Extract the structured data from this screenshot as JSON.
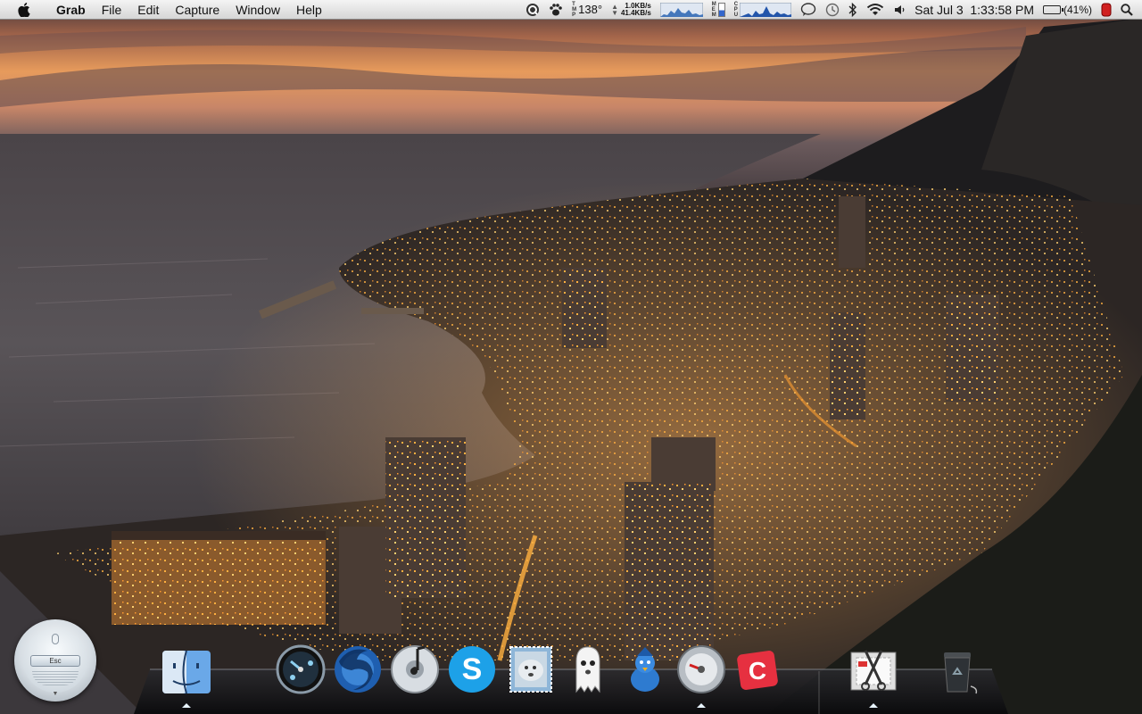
{
  "menubar": {
    "app_name": "Grab",
    "menus": [
      "File",
      "Edit",
      "Capture",
      "Window",
      "Help"
    ],
    "temperature": "138°",
    "net_up": "1.0KB/s",
    "net_down": "41.4KB/s",
    "clock": "Sat Jul 3  1:33:58 PM",
    "battery": "(41%)",
    "labels": {
      "tmp": [
        "T",
        "M",
        "P"
      ],
      "mem": [
        "M",
        "E",
        "M"
      ],
      "cpu": [
        "C",
        "P",
        "U"
      ]
    }
  },
  "widget": {
    "esc_label": "Esc"
  },
  "dock": {
    "apps": [
      {
        "name": "finder",
        "icon": "finder-icon",
        "running": true
      },
      {
        "name": "dashboard",
        "icon": "dashboard-icon",
        "running": false
      },
      {
        "name": "firefox",
        "icon": "firefox-icon",
        "running": false
      },
      {
        "name": "itunes",
        "icon": "itunes-icon",
        "running": false
      },
      {
        "name": "skype",
        "icon": "skype-icon",
        "running": false
      },
      {
        "name": "mail",
        "icon": "mail-icon",
        "running": false
      },
      {
        "name": "adium",
        "icon": "adium-ghost-icon",
        "running": false
      },
      {
        "name": "twitter",
        "icon": "twitter-bird-icon",
        "running": false
      },
      {
        "name": "system-preferences",
        "icon": "gear-icon",
        "running": true
      },
      {
        "name": "codepoint",
        "icon": "red-c-app-icon",
        "running": false
      },
      {
        "name": "grab",
        "icon": "grab-scissors-icon",
        "running": true
      },
      {
        "name": "trash",
        "icon": "trash-icon",
        "running": false
      }
    ]
  },
  "colors": {
    "accent": "#3b7dd8",
    "sky_top": "#4a3a3a",
    "sky_glow": "#f0a050"
  }
}
